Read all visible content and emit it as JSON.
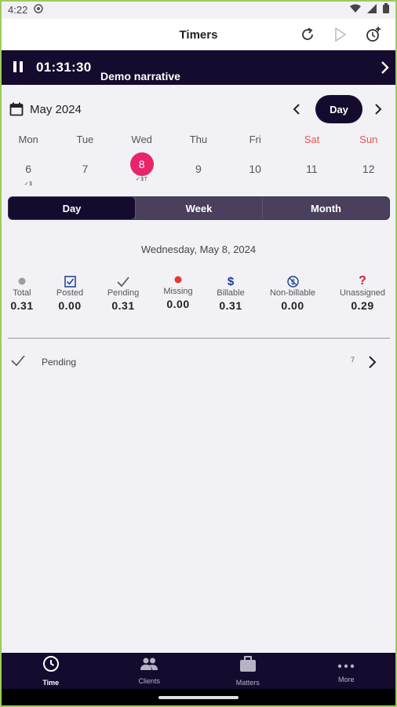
{
  "status": {
    "time": "4:22"
  },
  "appbar": {
    "title": "Timers"
  },
  "timer": {
    "elapsed": "01:31:30",
    "narrative": "Demo narrative"
  },
  "calendar": {
    "month": "May 2024",
    "view": "Day",
    "days": [
      {
        "name": "Mon",
        "num": "6",
        "marks": "✓$",
        "weekend": false,
        "selected": false
      },
      {
        "name": "Tue",
        "num": "7",
        "marks": "",
        "weekend": false,
        "selected": false
      },
      {
        "name": "Wed",
        "num": "8",
        "marks": "✓$T",
        "weekend": false,
        "selected": true
      },
      {
        "name": "Thu",
        "num": "9",
        "marks": "",
        "weekend": false,
        "selected": false
      },
      {
        "name": "Fri",
        "num": "10",
        "marks": "",
        "weekend": false,
        "selected": false
      },
      {
        "name": "Sat",
        "num": "11",
        "marks": "",
        "weekend": true,
        "selected": false
      },
      {
        "name": "Sun",
        "num": "12",
        "marks": "",
        "weekend": true,
        "selected": false
      }
    ]
  },
  "segments": {
    "day": "Day",
    "week": "Week",
    "month": "Month"
  },
  "full_date": "Wednesday, May 8, 2024",
  "stats": {
    "total": {
      "label": "Total",
      "value": "0.31"
    },
    "posted": {
      "label": "Posted",
      "value": "0.00"
    },
    "pending": {
      "label": "Pending",
      "value": "0.31"
    },
    "missing": {
      "label": "Missing",
      "value": "0.00"
    },
    "billable": {
      "label": "Billable",
      "value": "0.31"
    },
    "nonbillable": {
      "label": "Non-billable",
      "value": "0.00"
    },
    "unassigned": {
      "label": "Unassigned",
      "value": "0.29"
    }
  },
  "pending_row": {
    "label": "Pending",
    "count": "7"
  },
  "nav": {
    "time": "Time",
    "clients": "Clients",
    "matters": "Matters",
    "more": "More"
  },
  "colors": {
    "brand_dark": "#150b2e",
    "accent_pink": "#e8246b",
    "weekend_red": "#e8554e",
    "missing_red": "#e53935",
    "billable_blue": "#1a3d8f",
    "unassigned_red": "#c62828"
  }
}
